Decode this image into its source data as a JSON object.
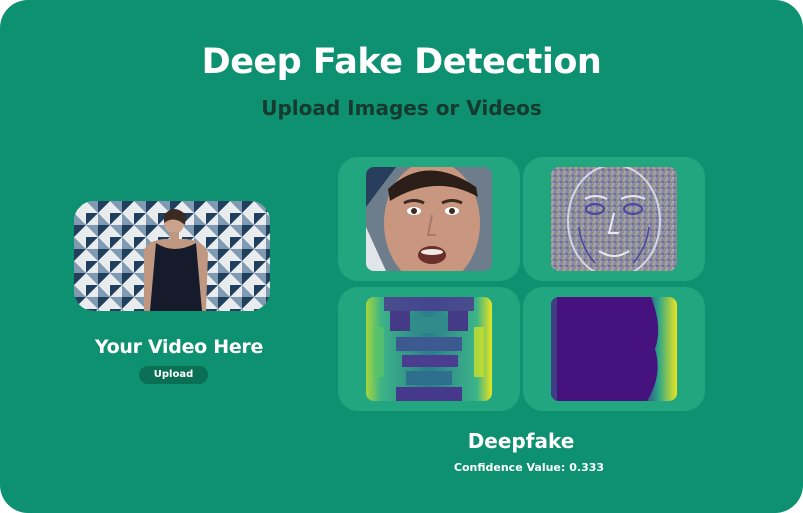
{
  "header": {
    "title": "Deep Fake Detection",
    "subtitle": "Upload Images or Videos"
  },
  "upload_panel": {
    "video_label": "Your Video Here",
    "upload_button_label": "Upload"
  },
  "result": {
    "verdict": "Deepfake",
    "confidence_label": "Confidence Value:",
    "confidence_value": "0.333"
  },
  "analysis_tiles": [
    {
      "name": "face-crop",
      "icon": "face-crop-image"
    },
    {
      "name": "edge-map",
      "icon": "edge-map-image"
    },
    {
      "name": "attention-heatmap",
      "icon": "heatmap-image"
    },
    {
      "name": "activation-map",
      "icon": "activation-map-image"
    }
  ],
  "colors": {
    "background": "#0e9170",
    "tile": "#21a680",
    "button": "#0b6f56",
    "subtitle": "#163a2f"
  }
}
